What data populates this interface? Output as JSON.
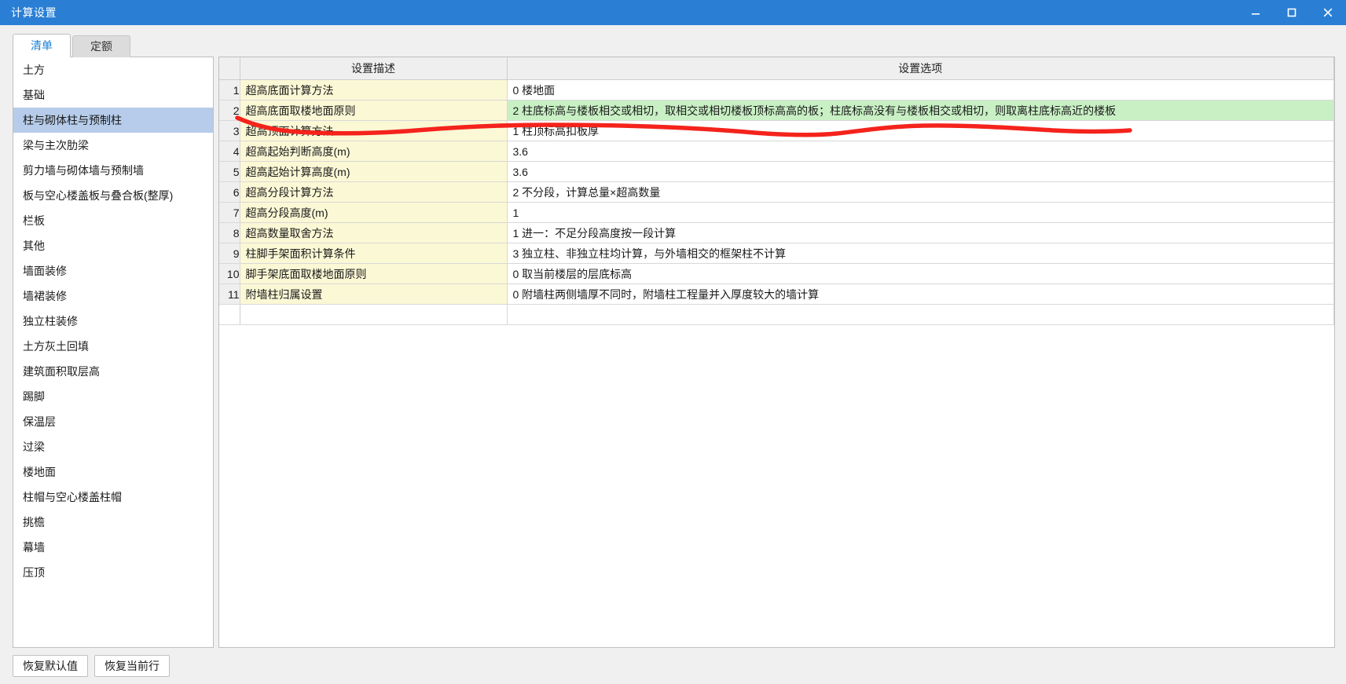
{
  "window": {
    "title": "计算设置",
    "controls": [
      {
        "name": "minimize-button",
        "glyph": "minimize"
      },
      {
        "name": "maximize-button",
        "glyph": "maximize"
      },
      {
        "name": "close-button",
        "glyph": "close"
      }
    ],
    "accent_color": "#2a7fd4"
  },
  "tabs": [
    {
      "label": "清单",
      "active": true
    },
    {
      "label": "定额",
      "active": false
    }
  ],
  "sidebar": {
    "selected_index": 2,
    "items": [
      {
        "label": "土方"
      },
      {
        "label": "基础"
      },
      {
        "label": "柱与砌体柱与预制柱"
      },
      {
        "label": "梁与主次肋梁"
      },
      {
        "label": "剪力墙与砌体墙与预制墙"
      },
      {
        "label": "板与空心楼盖板与叠合板(整厚)"
      },
      {
        "label": "栏板"
      },
      {
        "label": "其他"
      },
      {
        "label": "墙面装修"
      },
      {
        "label": "墙裙装修"
      },
      {
        "label": "独立柱装修"
      },
      {
        "label": "土方灰土回填"
      },
      {
        "label": "建筑面积取层高"
      },
      {
        "label": "踢脚"
      },
      {
        "label": "保温层"
      },
      {
        "label": "过梁"
      },
      {
        "label": "楼地面"
      },
      {
        "label": "柱帽与空心楼盖柱帽"
      },
      {
        "label": "挑檐"
      },
      {
        "label": "幕墙"
      },
      {
        "label": "压顶"
      }
    ]
  },
  "table": {
    "headers": {
      "index": "",
      "description": "设置描述",
      "option": "设置选项"
    },
    "highlight_row_index": 1,
    "highlight_color": "#c8f0c4",
    "description_cell_color": "#fbf8d5",
    "rows": [
      {
        "no": "1",
        "desc": "超高底面计算方法",
        "opt": "0 楼地面"
      },
      {
        "no": "2",
        "desc": "超高底面取楼地面原则",
        "opt": "2 柱底标高与楼板相交或相切，取相交或相切楼板顶标高高的板；柱底标高没有与楼板相交或相切，则取离柱底标高近的楼板"
      },
      {
        "no": "3",
        "desc": "超高顶面计算方法",
        "opt": "1 柱顶标高扣板厚"
      },
      {
        "no": "4",
        "desc": "超高起始判断高度(m)",
        "opt": "3.6"
      },
      {
        "no": "5",
        "desc": "超高起始计算高度(m)",
        "opt": "3.6"
      },
      {
        "no": "6",
        "desc": "超高分段计算方法",
        "opt": "2 不分段，计算总量×超高数量"
      },
      {
        "no": "7",
        "desc": "超高分段高度(m)",
        "opt": "1"
      },
      {
        "no": "8",
        "desc": "超高数量取舍方法",
        "opt": "1 进一：不足分段高度按一段计算"
      },
      {
        "no": "9",
        "desc": "柱脚手架面积计算条件",
        "opt": "3 独立柱、非独立柱均计算，与外墙相交的框架柱不计算"
      },
      {
        "no": "10",
        "desc": "脚手架底面取楼地面原则",
        "opt": "0 取当前楼层的层底标高"
      },
      {
        "no": "11",
        "desc": "附墙柱归属设置",
        "opt": "0 附墙柱两侧墙厚不同时，附墙柱工程量并入厚度较大的墙计算"
      }
    ]
  },
  "footer": {
    "buttons": [
      {
        "label": "恢复默认值",
        "name": "restore-defaults-button"
      },
      {
        "label": "恢复当前行",
        "name": "restore-current-row-button"
      }
    ]
  },
  "annotation": {
    "color": "#f4231c",
    "type": "hand-drawn-underline",
    "target_row": "2"
  }
}
